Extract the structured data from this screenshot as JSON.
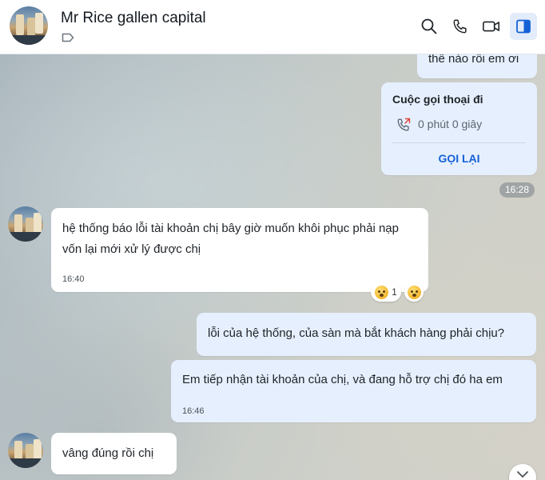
{
  "header": {
    "title": "Mr Rice gallen capital",
    "icons": [
      "tag-icon",
      "search-icon",
      "phone-icon",
      "video-call-icon",
      "side-panel-icon"
    ]
  },
  "messages": {
    "top_partial": "thế nào rồi em ơi",
    "call_card": {
      "title": "Cuộc gọi thoại đi",
      "duration": "0 phút 0 giây",
      "button": "GỌI LẠI"
    },
    "time_pill": "16:28",
    "msg1": {
      "text": "hệ thống báo lỗi tài khoản chị  bây giờ muốn khôi phục phải nạp vốn lại mới  xử lý được chị",
      "time": "16:40",
      "reaction_count": "1"
    },
    "msg2": {
      "text": "lỗi của hệ thống, của sàn mà bắt khách hàng phải chịu?"
    },
    "msg3": {
      "text": "Em tiếp nhận tài khoản của chị, và đang hỗ trợ chị đó ha em",
      "time": "16:46"
    },
    "msg4": {
      "text": "vâng  đúng rồi chị"
    }
  },
  "colors": {
    "my_bubble": "#e6effd",
    "their_bubble": "#ffffff",
    "accent": "#1461d6"
  }
}
